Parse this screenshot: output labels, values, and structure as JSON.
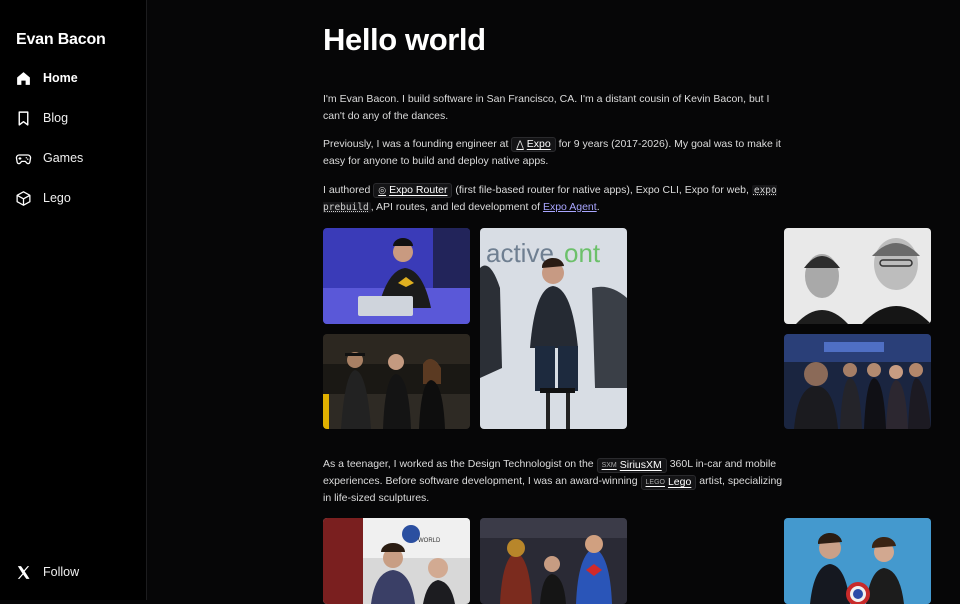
{
  "sidebar": {
    "brand": "Evan Bacon",
    "items": [
      {
        "label": "Home",
        "icon": "home-icon"
      },
      {
        "label": "Blog",
        "icon": "bookmark-icon"
      },
      {
        "label": "Games",
        "icon": "gamepad-icon"
      },
      {
        "label": "Lego",
        "icon": "cube-icon"
      }
    ],
    "follow": {
      "label": "Follow",
      "icon": "x-logo-icon"
    }
  },
  "main": {
    "title": "Hello world",
    "intro": {
      "text": "I'm Evan Bacon. I build software in San Francisco, CA. I'm a distant cousin of Kevin Bacon, but I can't do any of the dances."
    },
    "previously": {
      "before": "Previously, I was a founding engineer at",
      "chip": "Expo",
      "after": "for 9 years (2017-2026). My goal was to make it easy for anyone to build and deploy native apps."
    },
    "authored": {
      "before": "I authored",
      "chip": "Expo Router",
      "mid": "(first file-based router for native apps), Expo CLI, Expo for web,",
      "code": "expo prebuild",
      "after": ", API routes, and led development of",
      "link": "Expo Agent",
      "end": "."
    },
    "teenager": {
      "before": "As a teenager, I worked as the Design Technologist on the",
      "chip": "SiriusXM",
      "chip_icon_text": "SXM",
      "mid": "360L in-car and mobile experiences. Before software development, I was an award-winning",
      "chip2": "Lego",
      "chip2_icon_text": "LEGO",
      "after": "artist, specializing in life-sized sculptures."
    }
  },
  "colors": {
    "background": "#060607",
    "sidebar": "#000000",
    "link": "#a9a6ff",
    "text": "#dcdcdc"
  }
}
